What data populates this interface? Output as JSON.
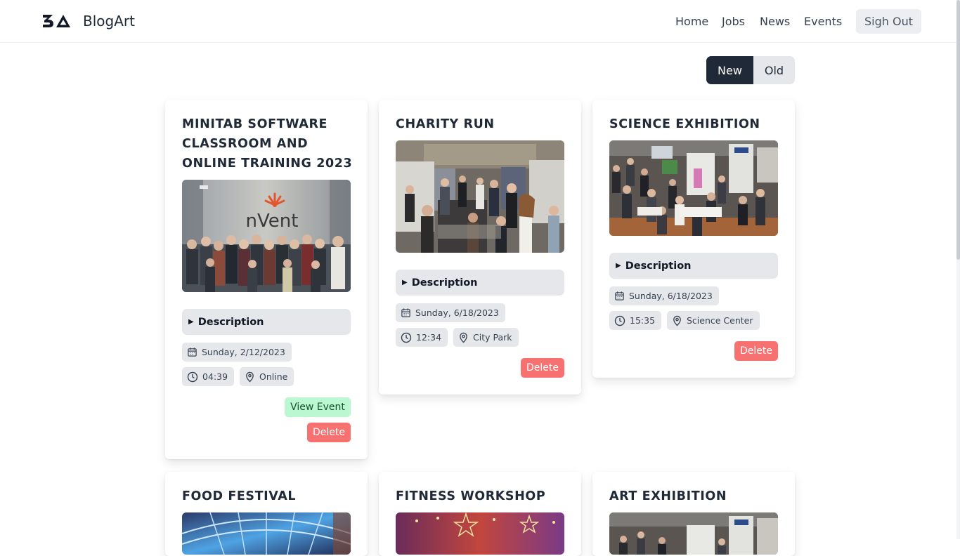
{
  "nav": {
    "brand": "BlogArt",
    "links": [
      "Home",
      "Jobs",
      "News",
      "Events"
    ],
    "signout": "Sigh Out"
  },
  "sort": {
    "new_label": "New",
    "old_label": "Old",
    "selected": "New"
  },
  "description_label": "Description",
  "events": [
    {
      "title": "MINITAB SOFTWARE CLASSROOM AND ONLINE TRAINING 2023",
      "date": "Sunday, 2/12/2023",
      "time": "04:39",
      "location": "Online",
      "view_label": "View Event",
      "delete_label": "Delete"
    },
    {
      "title": "CHARITY RUN",
      "date": "Sunday, 6/18/2023",
      "time": "12:34",
      "location": "City Park",
      "delete_label": "Delete"
    },
    {
      "title": "SCIENCE EXHIBITION",
      "date": "Sunday, 6/18/2023",
      "time": "15:35",
      "location": "Science Center",
      "delete_label": "Delete"
    },
    {
      "title": "FOOD FESTIVAL"
    },
    {
      "title": "FITNESS WORKSHOP"
    },
    {
      "title": "ART EXHIBITION"
    }
  ],
  "image_text": {
    "nvent_logo": "nVent"
  },
  "icons": {
    "calendar": "calendar-icon",
    "clock": "clock-icon",
    "location": "map-pin-icon",
    "logo": "logo-mark-icon"
  },
  "colors": {
    "primary": "#1f2937",
    "delete": "#f87171",
    "view": "#bbf7d0",
    "chip": "#e5e7eb"
  }
}
